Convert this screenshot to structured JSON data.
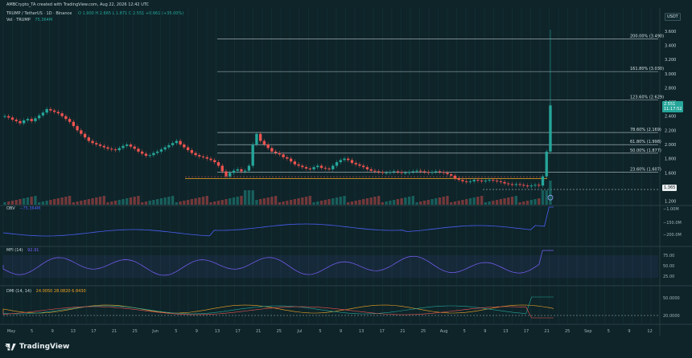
{
  "header": {
    "credit": "AMBCrypto_TA created with TradingView.com, Aug 22, 2026 12:42 UTC",
    "symbol_line": "TRUMP / TetherUS · 1D · Binance",
    "ohlc": "O 1.900  H 2.665  L 1.871  C 2.551  +0.661 (+35.00%)",
    "volume_label": "Vol · TRUMP",
    "volume_value": "75.364M"
  },
  "currency_badge": "USDT",
  "price_axis": {
    "ticks": [
      "3.600",
      "3.400",
      "3.200",
      "3.000",
      "2.800",
      "2.600",
      "2.400",
      "2.200",
      "2.000",
      "1.800",
      "1.600",
      "1.400",
      "1.200"
    ],
    "last_price": "2.551",
    "last_time": "11:17:52",
    "marker": "1.365"
  },
  "fib_levels": [
    {
      "label": "200.00% (3.490)",
      "value": 3.49
    },
    {
      "label": "161.80% (3.030)",
      "value": 3.03
    },
    {
      "label": "123.60% (2.629)",
      "value": 2.629
    },
    {
      "label": "78.60% (2.169)",
      "value": 2.169
    },
    {
      "label": "61.80% (1.998)",
      "value": 1.998
    },
    {
      "label": "50.00% (1.877)",
      "value": 1.877
    },
    {
      "label": "23.60% (1.607)",
      "value": 1.607
    }
  ],
  "indicators": {
    "obv": {
      "label": "OBV",
      "value": "−75.364M",
      "ticks": [
        "−1.00M",
        "−150.0M",
        "−200.0M"
      ]
    },
    "mfi": {
      "label": "MFI (14)",
      "value": "92.91",
      "ticks": [
        "75.00",
        "50.00",
        "25.00"
      ]
    },
    "dmi": {
      "label": "DMI (14, 14)",
      "values": "24.0050  28.0820  6.8430",
      "ticks": [
        "50.0000",
        "20.0000"
      ]
    }
  },
  "x_axis": {
    "ticks": [
      "May",
      "5",
      "9",
      "13",
      "17",
      "21",
      "25",
      "Jun",
      "5",
      "9",
      "13",
      "17",
      "21",
      "25",
      "Jul",
      "5",
      "9",
      "13",
      "17",
      "21",
      "25",
      "Aug",
      "5",
      "9",
      "13",
      "17",
      "21",
      "25",
      "Sep",
      "5",
      "9",
      "12"
    ]
  },
  "logo": "TradingView",
  "colors": {
    "up": "#26a69a",
    "down": "#ef5350",
    "bg": "#0e2429",
    "fib": "#b9c8cc",
    "support": "#f5a623",
    "obv": "#4b5ef2",
    "mfi": "#7b61ff"
  },
  "chart_data": {
    "type": "candlestick",
    "title": "TRUMP / TetherUS · 1D · Binance",
    "closes": [
      2.4,
      2.38,
      2.35,
      2.33,
      2.3,
      2.34,
      2.36,
      2.33,
      2.37,
      2.41,
      2.45,
      2.5,
      2.48,
      2.46,
      2.44,
      2.4,
      2.36,
      2.32,
      2.26,
      2.2,
      2.15,
      2.1,
      2.05,
      2.02,
      2.0,
      1.98,
      1.96,
      1.94,
      1.93,
      1.92,
      1.95,
      1.98,
      2.0,
      1.97,
      1.94,
      1.9,
      1.87,
      1.84,
      1.85,
      1.88,
      1.9,
      1.93,
      1.96,
      1.99,
      2.02,
      2.05,
      2.0,
      1.96,
      1.92,
      1.88,
      1.85,
      1.83,
      1.82,
      1.8,
      1.78,
      1.75,
      1.7,
      1.62,
      1.55,
      1.6,
      1.63,
      1.65,
      1.62,
      1.63,
      1.7,
      2.0,
      2.15,
      2.05,
      2.0,
      1.95,
      1.9,
      1.88,
      1.86,
      1.82,
      1.8,
      1.76,
      1.72,
      1.7,
      1.68,
      1.66,
      1.65,
      1.68,
      1.7,
      1.67,
      1.66,
      1.65,
      1.7,
      1.75,
      1.78,
      1.8,
      1.78,
      1.74,
      1.72,
      1.7,
      1.68,
      1.65,
      1.63,
      1.62,
      1.61,
      1.6,
      1.6,
      1.61,
      1.62,
      1.61,
      1.6,
      1.6,
      1.61,
      1.62,
      1.63,
      1.62,
      1.61,
      1.6,
      1.61,
      1.62,
      1.61,
      1.6,
      1.58,
      1.56,
      1.52,
      1.5,
      1.48,
      1.47,
      1.48,
      1.5,
      1.49,
      1.48,
      1.49,
      1.5,
      1.49,
      1.48,
      1.47,
      1.45,
      1.44,
      1.43,
      1.44,
      1.43,
      1.42,
      1.41,
      1.42,
      1.43,
      1.42,
      1.55,
      1.9,
      2.551
    ],
    "volume_spike_index": [
      63,
      64,
      65,
      141,
      142,
      143
    ],
    "ylim": [
      1.15,
      3.7
    ]
  }
}
